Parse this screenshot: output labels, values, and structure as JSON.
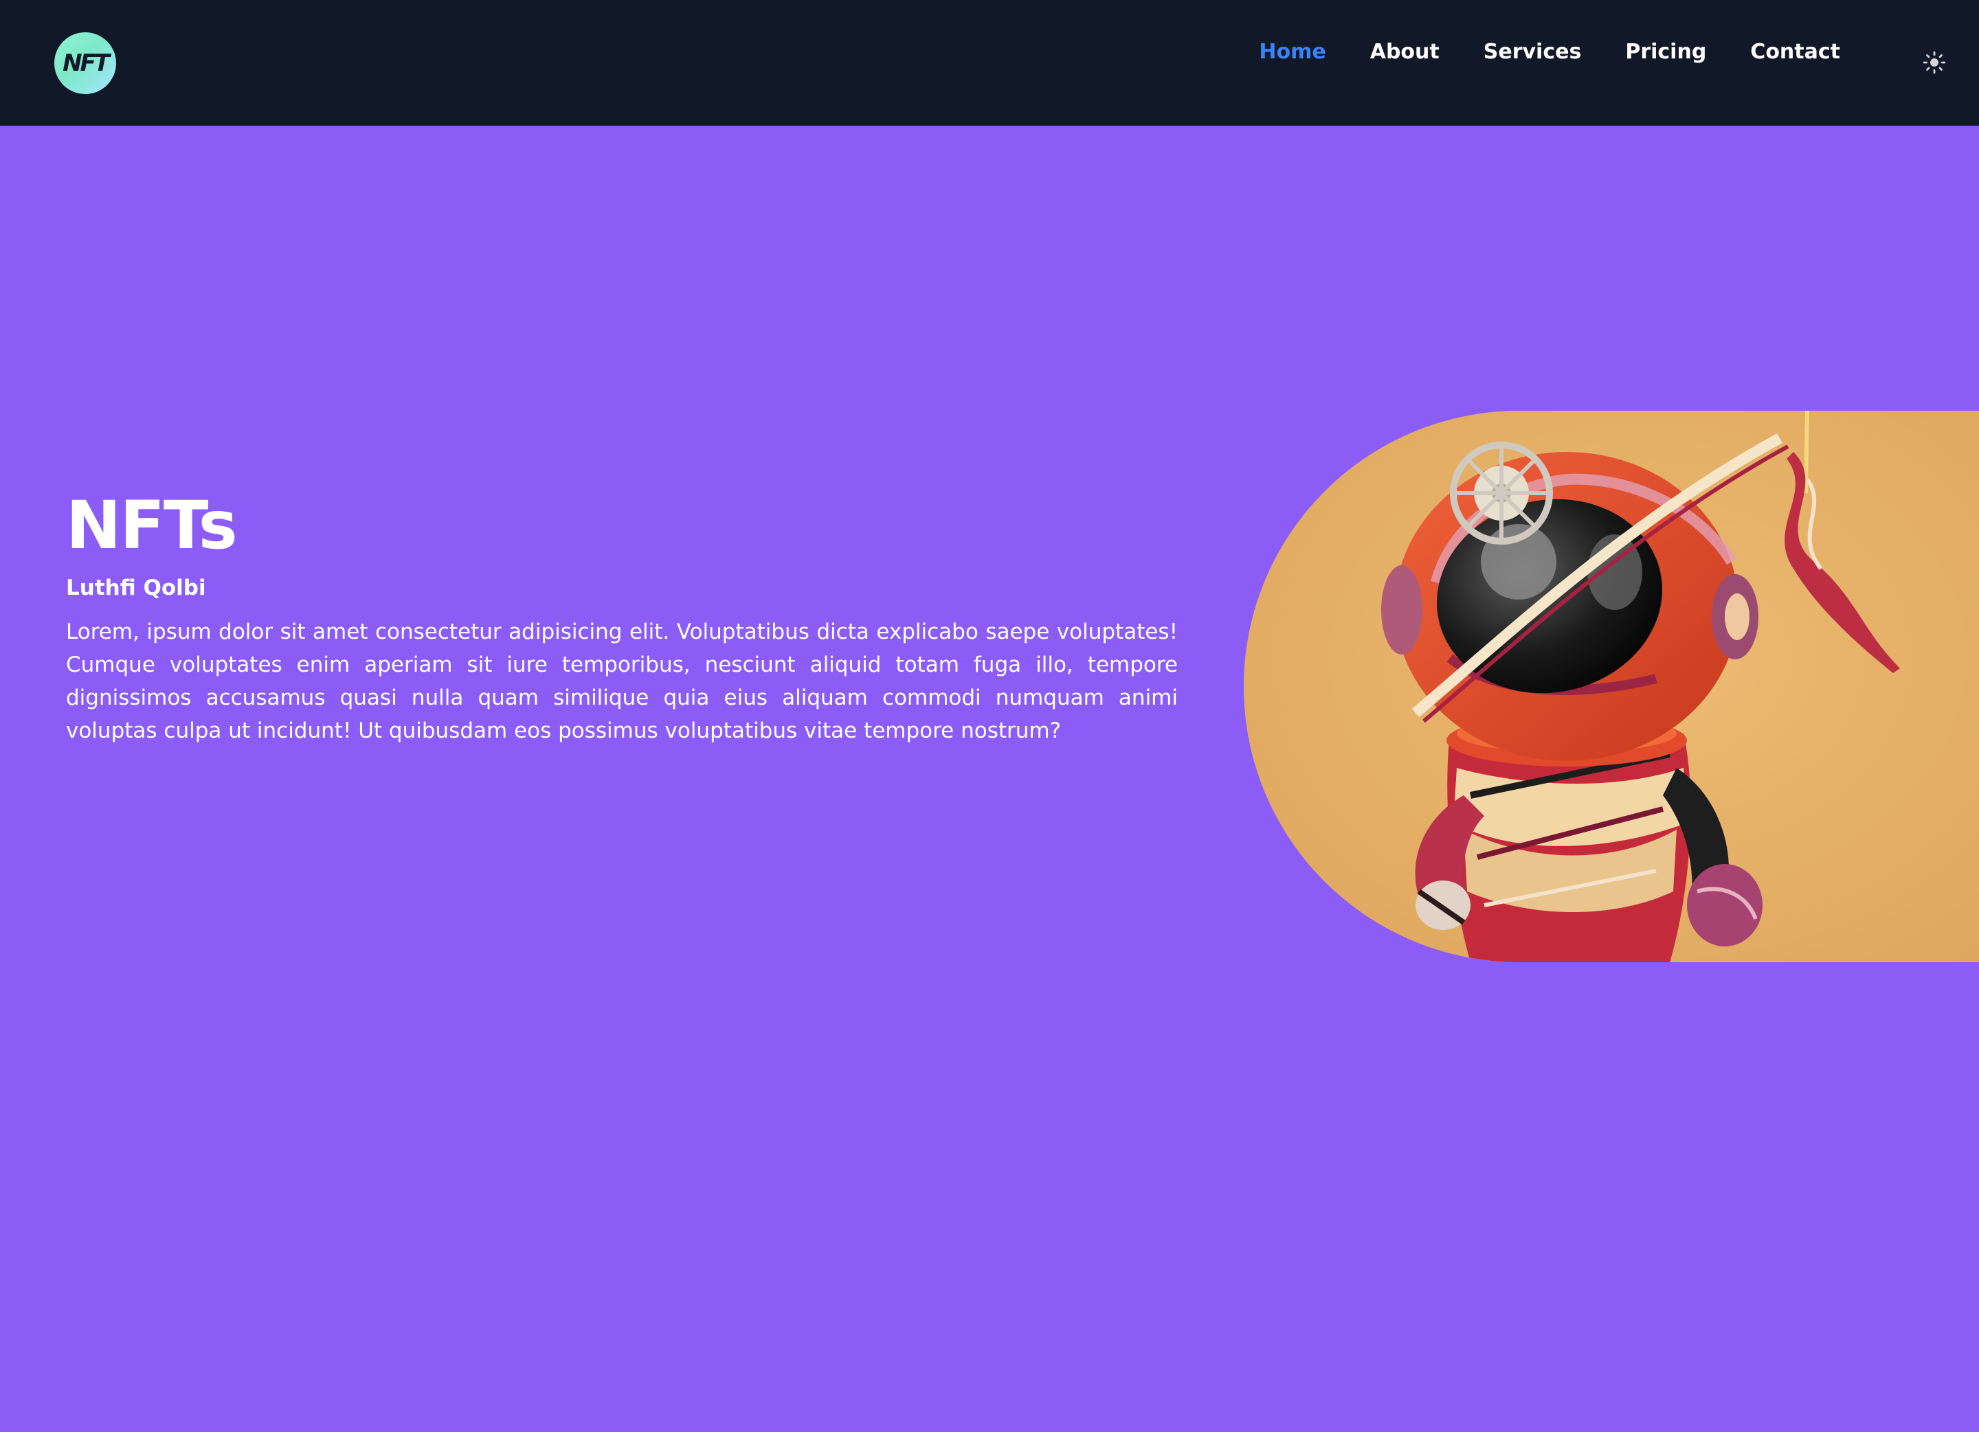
{
  "header": {
    "logo_text": "NFT",
    "nav": [
      {
        "label": "Home",
        "active": true
      },
      {
        "label": "About",
        "active": false
      },
      {
        "label": "Services",
        "active": false
      },
      {
        "label": "Pricing",
        "active": false
      },
      {
        "label": "Contact",
        "active": false
      }
    ],
    "theme_toggle_icon": "sun-icon"
  },
  "hero": {
    "title": "NFTs",
    "author": "Luthfi Qolbi",
    "description": "Lorem, ipsum dolor sit amet consectetur adipisicing elit. Voluptatibus dicta explicabo saepe voluptates! Cumque voluptates enim aperiam sit iure temporibus, nesciunt aliquid totam fuga illo, tempore dignissimos accusamus quasi nulla quam similique quia eius aliquam commodi numquam animi voluptas culpa ut incidunt! Ut quibusdam eos possimus voluptatibus vitae tempore nostrum?",
    "image": "astronaut-nft-figure"
  },
  "colors": {
    "nav_bg": "#111827",
    "page_bg": "#8b5cf6",
    "active_link": "#3b82f6",
    "image_bg": "#e6b066"
  }
}
